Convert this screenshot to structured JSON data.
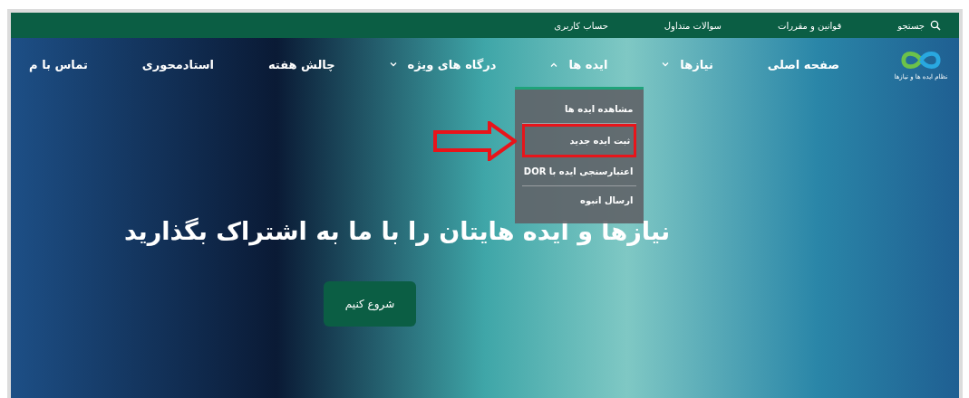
{
  "top_bar": {
    "links": [
      {
        "label": "جستجو",
        "kind": "search"
      },
      {
        "label": "قوانین و مقررات",
        "kind": "link"
      },
      {
        "label": "سوالات متداول",
        "kind": "link"
      },
      {
        "label": "حساب کاربری",
        "kind": "link"
      }
    ]
  },
  "nav": {
    "logo_caption": "نظام ایده ها و نیازها",
    "items": [
      {
        "label": "صفحه اصلی",
        "dropdown": false
      },
      {
        "label": "نیازها",
        "dropdown": true,
        "expanded": false
      },
      {
        "label": "ایده ها",
        "dropdown": true,
        "expanded": true,
        "menu": [
          {
            "label": "مشاهده ایده ها",
            "highlighted": false
          },
          {
            "label": "ثبت ایده جدید",
            "highlighted": true
          },
          {
            "label": "اعتبارسنجی ایده با DOR",
            "highlighted": false
          },
          {
            "label": "ارسال انبوه",
            "highlighted": false
          }
        ]
      },
      {
        "label": "درگاه های ویژه",
        "dropdown": true,
        "expanded": false
      },
      {
        "label": "چالش هفته",
        "dropdown": false
      },
      {
        "label": "استادمحوری",
        "dropdown": false
      },
      {
        "label": "تماس با م",
        "dropdown": false
      }
    ]
  },
  "hero": {
    "title": "نیازها و ایده هایتان را با ما به اشتراک بگذارید",
    "button": "شروع کنیم"
  }
}
